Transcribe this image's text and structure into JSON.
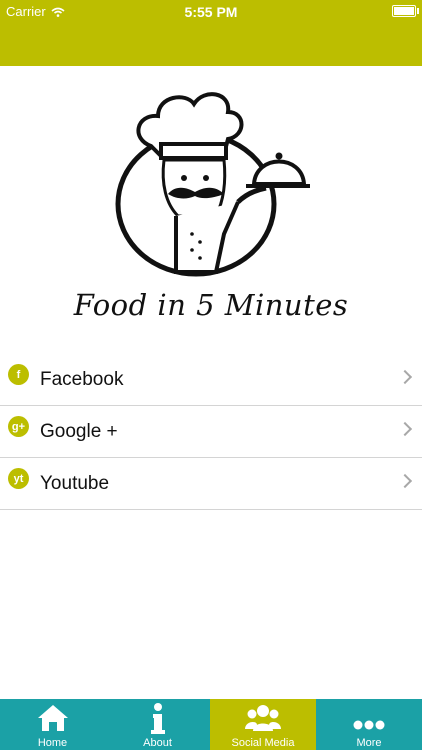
{
  "status": {
    "carrier": "Carrier",
    "time": "5:55 PM",
    "battery_level": 1.0
  },
  "brand": {
    "name": "Food in 5 Minutes"
  },
  "social": [
    {
      "label": "Facebook",
      "icon": "facebook-icon",
      "glyph": "f"
    },
    {
      "label": "Google +",
      "icon": "google-plus-icon",
      "glyph": "g+"
    },
    {
      "label": "Youtube",
      "icon": "youtube-icon",
      "glyph": "yt"
    }
  ],
  "tabs": [
    {
      "label": "Home",
      "icon": "home-icon"
    },
    {
      "label": "About",
      "icon": "info-icon"
    },
    {
      "label": "Social Media",
      "icon": "users-icon",
      "active": true
    },
    {
      "label": "More",
      "icon": "more-icon"
    }
  ],
  "colors": {
    "accent": "#bcbe00",
    "tabbar": "#1ba1a6",
    "divider": "#d4d4d4"
  }
}
